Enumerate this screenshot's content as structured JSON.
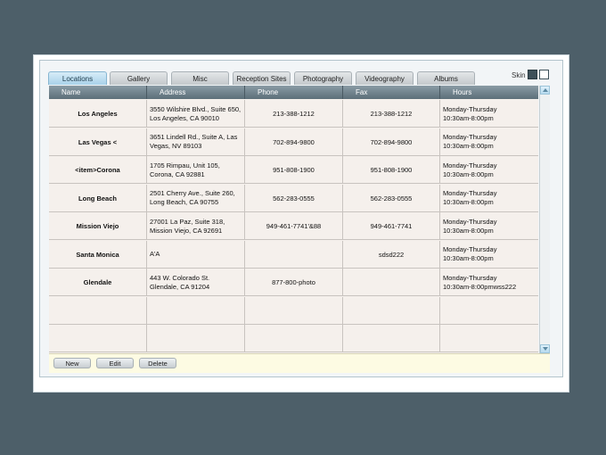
{
  "skin": {
    "label": "Skin"
  },
  "tabs": [
    {
      "label": "Locations"
    },
    {
      "label": "Gallery"
    },
    {
      "label": "Misc"
    },
    {
      "label": "Reception Sites"
    },
    {
      "label": "Photography"
    },
    {
      "label": "Videography"
    },
    {
      "label": "Albums"
    }
  ],
  "active_tab": "Locations",
  "table": {
    "columns": [
      "Name",
      "Address",
      "Phone",
      "Fax",
      "Hours"
    ],
    "rows": [
      {
        "name": "Los Angeles",
        "address": "3550 Wilshire Blvd., Suite 650,\nLos Angeles, CA 90010",
        "phone": "213-388-1212",
        "fax": "213-388-1212",
        "hours": "Monday-Thursday\n10:30am-8:00pm"
      },
      {
        "name": "Las Vegas <",
        "address": "3651 Lindell Rd., Suite A, Las\nVegas, NV 89103",
        "phone": "702-894-9800",
        "fax": "702-894-9800",
        "hours": "Monday-Thursday\n10:30am-8:00pm"
      },
      {
        "name": "<item>Corona",
        "address": "1705 Rimpau, Unit 105,\nCorona, CA 92881",
        "phone": "951-808-1900",
        "fax": "951-808-1900",
        "hours": "Monday-Thursday\n10:30am-8:00pm"
      },
      {
        "name": "Long Beach",
        "address": "2501 Cherry Ave., Suite 260,\nLong Beach, CA 90755",
        "phone": "562-283-0555",
        "fax": "562-283-0555",
        "hours": "Monday-Thursday\n10:30am-8:00pm"
      },
      {
        "name": "Mission Viejo",
        "address": "27001 La Paz, Suite 318,\nMission Viejo, CA  92691",
        "phone": "949-461-7741'&88",
        "fax": "949-461-7741",
        "hours": "Monday-Thursday\n10:30am-8:00pm"
      },
      {
        "name": "Santa Monica",
        "address": "A'A",
        "phone": "",
        "fax": "sdsd222",
        "hours": "Monday-Thursday\n10:30am-8:00pm"
      },
      {
        "name": "Glendale",
        "address": "443 W. Colorado St.\nGlendale, CA 91204",
        "phone": "877-800-photo",
        "fax": "",
        "hours": "Monday-Thursday\n10:30am-8:00pmwss222"
      },
      {
        "name": "",
        "address": "",
        "phone": "",
        "fax": "",
        "hours": ""
      },
      {
        "name": "",
        "address": "",
        "phone": "",
        "fax": "",
        "hours": ""
      }
    ]
  },
  "footer": {
    "new_label": "New",
    "edit_label": "Edit",
    "delete_label": "Delete"
  },
  "colors": {
    "background": "#4d5f69",
    "header": "#6e808a",
    "active_tab": "#b9dcef",
    "row": "#f5f0ec",
    "footer": "#fdfbe3"
  }
}
